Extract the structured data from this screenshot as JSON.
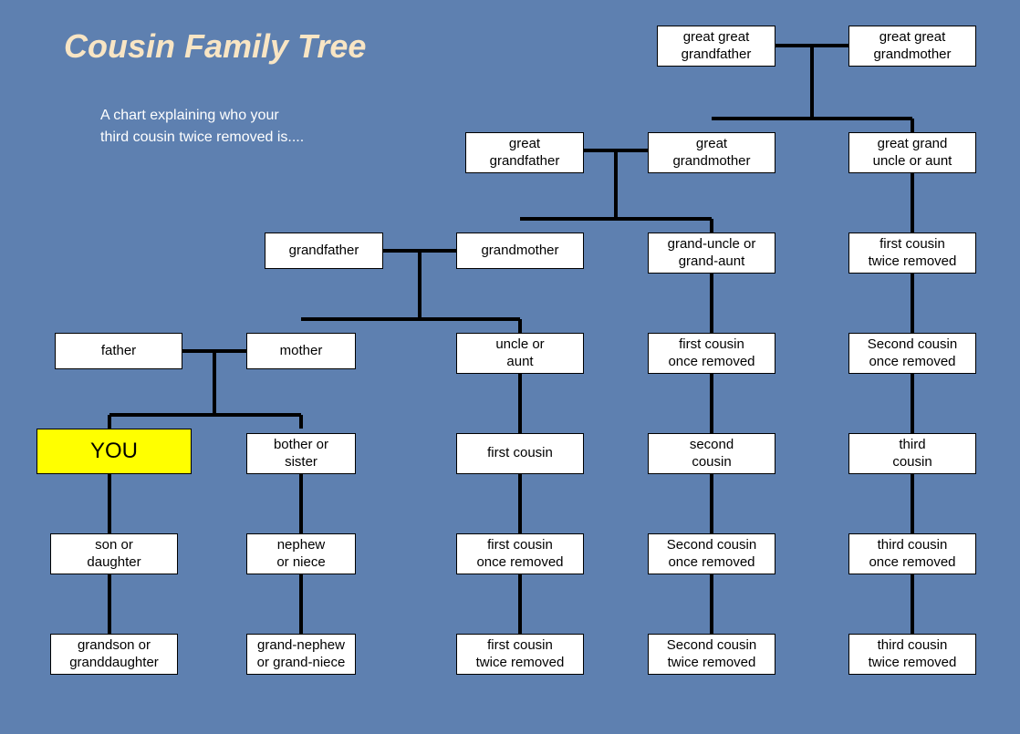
{
  "title": "Cousin Family Tree",
  "subtitle": "A chart explaining who your\nthird cousin twice removed is....",
  "chart_data": {
    "type": "tree",
    "nodes": {
      "gg_grandfather": "great great\ngrandfather",
      "gg_grandmother": "great great\ngrandmother",
      "g_grandfather": "great\ngrandfather",
      "g_grandmother": "great\ngrandmother",
      "gg_uncle_aunt": "great grand\nuncle or aunt",
      "grandfather": "grandfather",
      "grandmother": "grandmother",
      "grand_uncle_aunt": "grand-uncle or\ngrand-aunt",
      "fc_twice_rem_a": "first cousin\ntwice removed",
      "father": "father",
      "mother": "mother",
      "uncle_aunt": "uncle or\naunt",
      "fc_once_rem_a": "first cousin\nonce removed",
      "sc_once_rem_a": "Second cousin\nonce removed",
      "you": "YOU",
      "sibling": "bother or\nsister",
      "first_cousin": "first cousin",
      "second_cousin": "second\ncousin",
      "third_cousin": "third\ncousin",
      "son_daughter": "son or\ndaughter",
      "nephew_niece": "nephew\nor niece",
      "fc_once_rem_b": "first cousin\nonce removed",
      "sc_once_rem_b": "Second cousin\nonce removed",
      "tc_once_rem": "third cousin\nonce removed",
      "grandchild": "grandson or\ngranddaughter",
      "grand_nephew": "grand-nephew\nor grand-niece",
      "fc_twice_rem_b": "first cousin\ntwice removed",
      "sc_twice_rem": "Second cousin\ntwice removed",
      "tc_twice_rem": "third cousin\ntwice removed"
    }
  }
}
